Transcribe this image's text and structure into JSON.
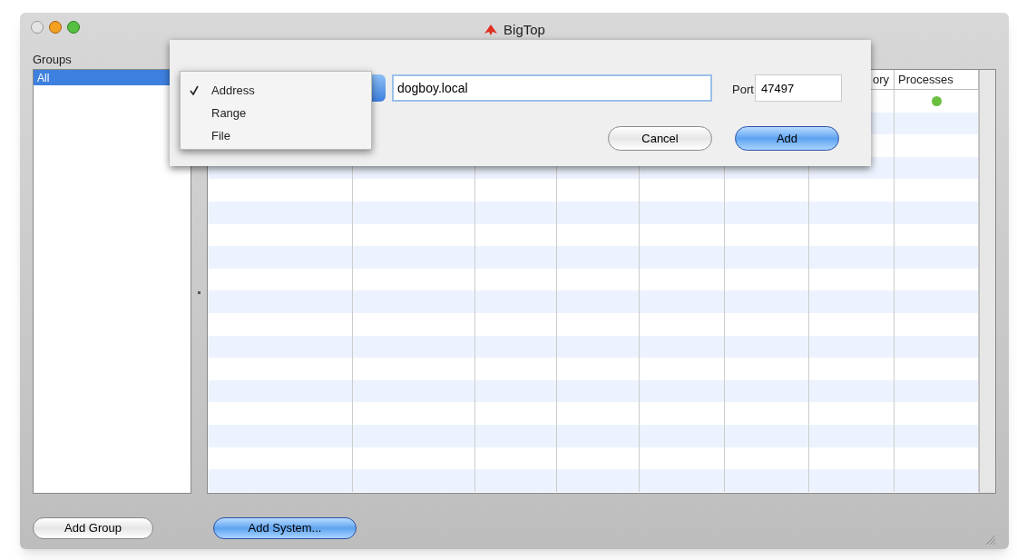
{
  "window": {
    "title": "BigTop"
  },
  "groups": {
    "label": "Groups",
    "items": [
      {
        "label": "All",
        "selected": true
      }
    ]
  },
  "table": {
    "columns": [
      {
        "header": "ory"
      },
      {
        "header": "Processes"
      }
    ],
    "rows": [
      {
        "color": "#6cc040"
      }
    ]
  },
  "buttons": {
    "add_group": "Add Group",
    "add_system": "Add System..."
  },
  "sheet": {
    "address_menu": [
      {
        "label": "Address",
        "checked": true
      },
      {
        "label": "Range",
        "checked": false
      },
      {
        "label": "File",
        "checked": false
      }
    ],
    "address_value": "dogboy.local",
    "port_label": "Port",
    "port_value": "47497",
    "cancel": "Cancel",
    "add": "Add"
  }
}
